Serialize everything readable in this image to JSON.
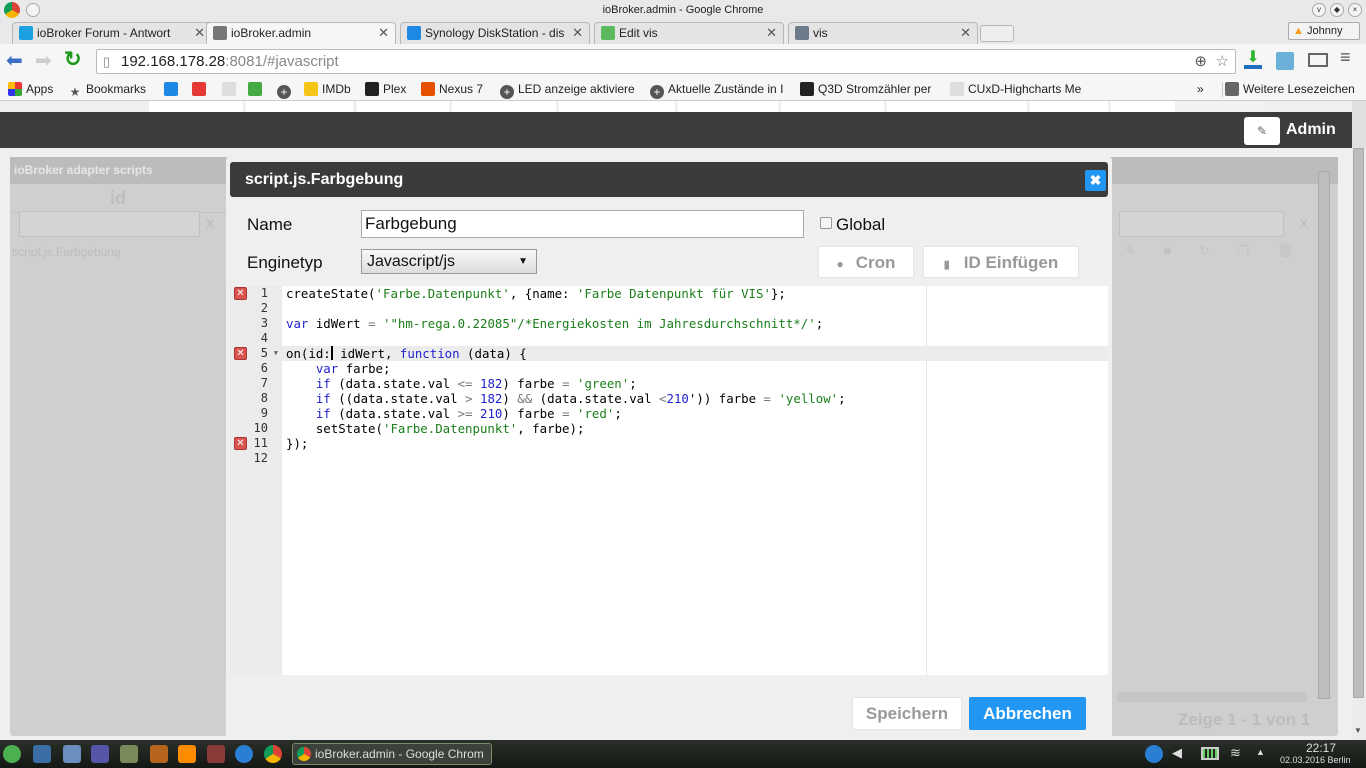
{
  "window": {
    "title": "ioBroker.admin - Google Chrome",
    "profile": "Johnny"
  },
  "tabs": [
    {
      "label": "ioBroker Forum - Antwort",
      "icon": "iobroker-icon",
      "color": "#1ba1e2"
    },
    {
      "label": "ioBroker.admin",
      "icon": "gear-icon",
      "color": "#777777",
      "active": true
    },
    {
      "label": "Synology DiskStation - dis",
      "icon": "dsm-icon",
      "color": "#1e88e5"
    },
    {
      "label": "Edit vis",
      "icon": "vis-edit-icon",
      "color": "#5cb85c"
    },
    {
      "label": "vis",
      "icon": "home-icon",
      "color": "#6c7a89"
    }
  ],
  "address": {
    "host": "192.168.178.28",
    "rest": ":8081/#javascript"
  },
  "bookmarks": [
    {
      "label": "Apps",
      "icon": "apps-icon"
    },
    {
      "label": "Bookmarks",
      "icon": "star-icon"
    },
    {
      "label": "",
      "icon": "dsm-icon"
    },
    {
      "label": "",
      "icon": "fritz-icon"
    },
    {
      "label": "",
      "icon": "page-icon"
    },
    {
      "label": "",
      "icon": "gecko-icon"
    },
    {
      "label": "",
      "icon": "plus-circle-icon"
    },
    {
      "label": "IMDb",
      "icon": "imdb-icon"
    },
    {
      "label": "Plex",
      "icon": "plex-icon"
    },
    {
      "label": "Nexus 7",
      "icon": "xda-icon"
    },
    {
      "label": "LED anzeige aktiviere",
      "icon": "plus-circle-icon"
    },
    {
      "label": "Aktuelle Zustände in I",
      "icon": "plus-circle-icon"
    },
    {
      "label": "Q3D Stromzähler per",
      "icon": "meter-icon"
    },
    {
      "label": "CUxD-Highcharts Me",
      "icon": "page-icon"
    }
  ],
  "bookmarks_more": "»",
  "other_bookmarks": "Weitere Lesezeichen",
  "app": {
    "user": "Admin"
  },
  "background": {
    "panel_title": "ioBroker adapter scripts",
    "column": "id",
    "filter_clear": "x",
    "row": "script.js.Farbgebung",
    "pager": "Zeige 1 - 1 von 1"
  },
  "dialog": {
    "title": "script.js.Farbgebung",
    "name_label": "Name",
    "name_value": "Farbgebung",
    "global_label": "Global",
    "global_checked": false,
    "engine_label": "Enginetyp",
    "engine_value": "Javascript/js",
    "cron_label": "Cron",
    "id_insert_label": "ID Einfügen",
    "save_label": "Speichern",
    "cancel_label": "Abbrechen",
    "accent": "#2196f3"
  },
  "code": {
    "active_line": 5,
    "error_lines": [
      1,
      5,
      11
    ],
    "fold_lines": [
      5
    ],
    "lines": [
      [
        [
          "",
          "createState("
        ],
        [
          "s",
          "'Farbe.Datenpunkt'"
        ],
        [
          "",
          ", {name: "
        ],
        [
          "s",
          "'Farbe Datenpunkt für VIS'"
        ],
        [
          "",
          "};"
        ]
      ],
      [],
      [
        [
          "k",
          "var"
        ],
        [
          "",
          " idWert "
        ],
        [
          "o",
          "="
        ],
        [
          "",
          " "
        ],
        [
          "s",
          "'\"hm-rega.0.22085\"/*Energiekosten im Jahresdurchschnitt*/'"
        ],
        [
          "",
          ";"
        ]
      ],
      [],
      [
        [
          "",
          "on(id:"
        ],
        [
          "cursor",
          ""
        ],
        [
          "",
          " idWert, "
        ],
        [
          "k",
          "function"
        ],
        [
          "",
          " (data) {"
        ]
      ],
      [
        [
          "",
          "    "
        ],
        [
          "k",
          "var"
        ],
        [
          "",
          " farbe;"
        ]
      ],
      [
        [
          "",
          "    "
        ],
        [
          "k",
          "if"
        ],
        [
          "",
          " (data.state.val "
        ],
        [
          "o",
          "<="
        ],
        [
          "",
          " "
        ],
        [
          "n",
          "182"
        ],
        [
          "",
          ") farbe "
        ],
        [
          "o",
          "="
        ],
        [
          "",
          " "
        ],
        [
          "s",
          "'green'"
        ],
        [
          "",
          ";"
        ]
      ],
      [
        [
          "",
          "    "
        ],
        [
          "k",
          "if"
        ],
        [
          "",
          " ((data.state.val "
        ],
        [
          "o",
          ">"
        ],
        [
          "",
          " "
        ],
        [
          "n",
          "182"
        ],
        [
          "",
          ") "
        ],
        [
          "o",
          "&&"
        ],
        [
          "",
          " (data.state.val "
        ],
        [
          "o",
          "<"
        ],
        [
          "n",
          "210"
        ],
        [
          "",
          "')) farbe "
        ],
        [
          "o",
          "="
        ],
        [
          "",
          " "
        ],
        [
          "s",
          "'yellow'"
        ],
        [
          "",
          ";"
        ]
      ],
      [
        [
          "",
          "    "
        ],
        [
          "k",
          "if"
        ],
        [
          "",
          " (data.state.val "
        ],
        [
          "o",
          ">="
        ],
        [
          "",
          " "
        ],
        [
          "n",
          "210"
        ],
        [
          "",
          ") farbe "
        ],
        [
          "o",
          "="
        ],
        [
          "",
          " "
        ],
        [
          "s",
          "'red'"
        ],
        [
          "",
          ";"
        ]
      ],
      [
        [
          "",
          "    setState("
        ],
        [
          "s",
          "'Farbe.Datenpunkt'"
        ],
        [
          "",
          ", farbe);"
        ]
      ],
      [
        [
          "",
          "});"
        ]
      ],
      []
    ]
  },
  "taskbar": {
    "window_label": "ioBroker.admin - Google Chrom",
    "time": "22:17",
    "date": "02.03.2016 Berlin"
  }
}
